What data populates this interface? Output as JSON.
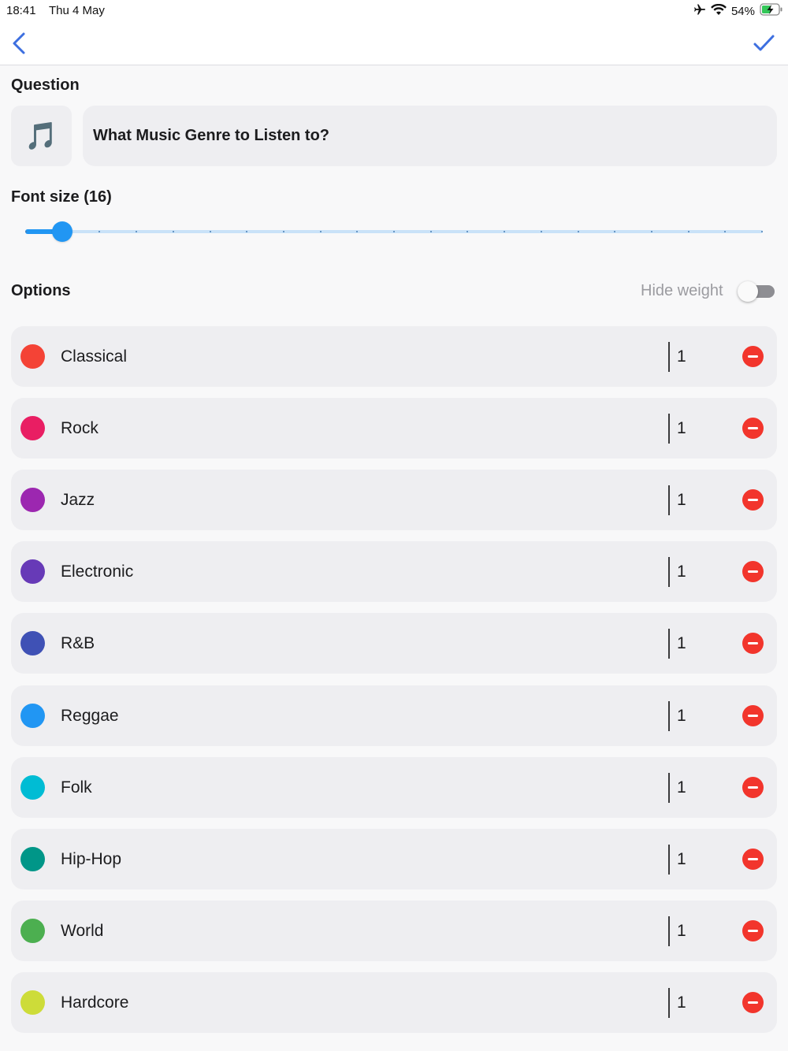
{
  "status_bar": {
    "time": "18:41",
    "date": "Thu 4 May",
    "battery_percent": "54%",
    "icons": [
      "airplane-icon",
      "wifi-icon",
      "battery-charging-icon"
    ]
  },
  "nav": {
    "back_icon": "chevron-left-icon",
    "done_icon": "checkmark-icon",
    "accent_color": "#3d6fe0"
  },
  "question": {
    "section_title": "Question",
    "icon": "musical-note-icon",
    "icon_glyph": "🎵",
    "text": "What Music Genre to Listen to?"
  },
  "font_size": {
    "label": "Font size (16)",
    "value": 16,
    "slider_fraction": 0.05,
    "tick_count": 21,
    "accent_color": "#2196f3"
  },
  "options_section": {
    "title": "Options",
    "hide_weight_label": "Hide weight",
    "hide_weight_on": false
  },
  "options": [
    {
      "name": "Classical",
      "weight": "1",
      "color": "#f44336"
    },
    {
      "name": "Rock",
      "weight": "1",
      "color": "#e91e63"
    },
    {
      "name": "Jazz",
      "weight": "1",
      "color": "#9c27b0"
    },
    {
      "name": "Electronic",
      "weight": "1",
      "color": "#673ab7"
    },
    {
      "name": "R&B",
      "weight": "1",
      "color": "#3f51b5"
    },
    {
      "name": "Reggae",
      "weight": "1",
      "color": "#2196f3"
    },
    {
      "name": "Folk",
      "weight": "1",
      "color": "#00bcd4"
    },
    {
      "name": "Hip-Hop",
      "weight": "1",
      "color": "#009688"
    },
    {
      "name": "World",
      "weight": "1",
      "color": "#4caf50"
    },
    {
      "name": "Hardcore",
      "weight": "1",
      "color": "#cddc39"
    }
  ],
  "remove_button_color": "#f2352c"
}
